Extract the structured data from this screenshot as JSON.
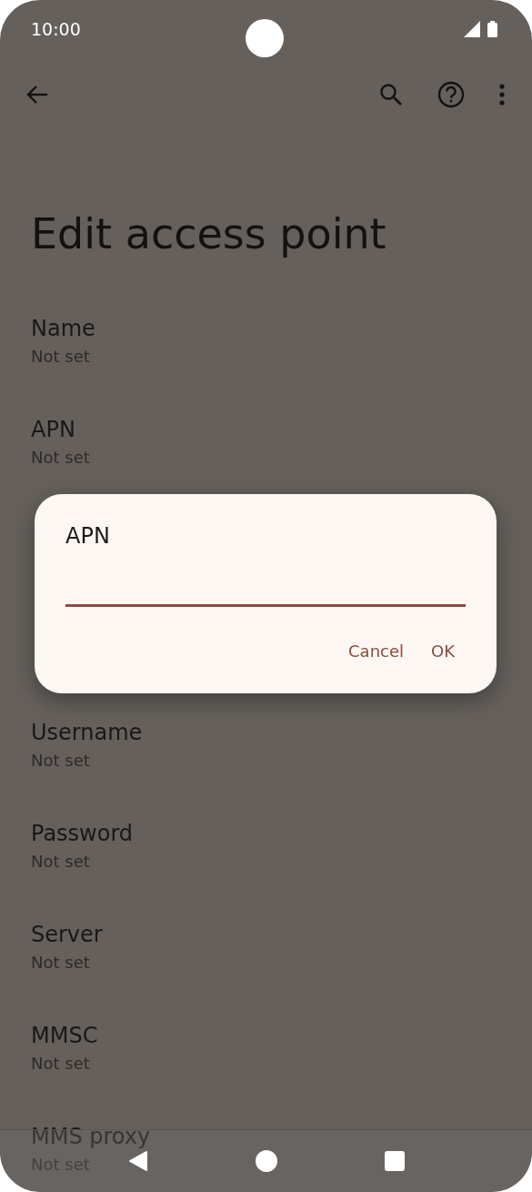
{
  "status_bar": {
    "time": "10:00"
  },
  "title": "Edit access point",
  "fields_above": [
    {
      "label": "Name",
      "value": "Not set"
    },
    {
      "label": "APN",
      "value": "Not set"
    }
  ],
  "fields_below": [
    {
      "label": "Username",
      "value": "Not set"
    },
    {
      "label": "Password",
      "value": "Not set"
    },
    {
      "label": "Server",
      "value": "Not set"
    },
    {
      "label": "MMSC",
      "value": "Not set"
    },
    {
      "label": "MMS proxy",
      "value": "Not set"
    }
  ],
  "dialog": {
    "title": "APN",
    "buttons": [
      "Cancel",
      "OK"
    ]
  }
}
